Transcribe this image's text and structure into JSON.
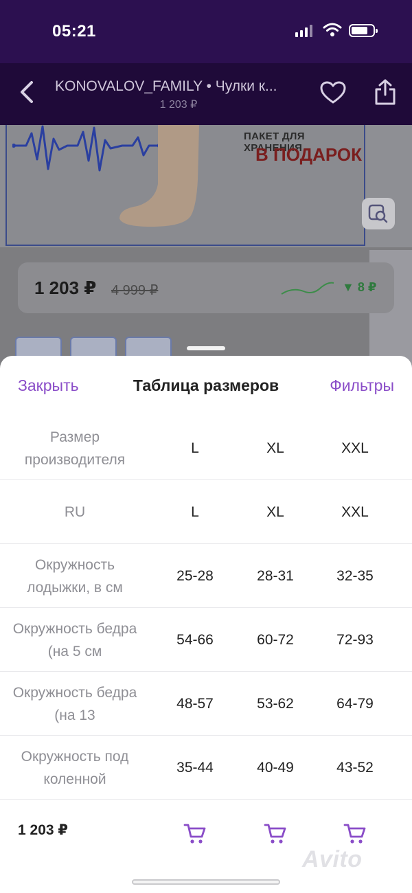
{
  "status_bar": {
    "time": "05:21"
  },
  "nav": {
    "title": "KONOVALOV_FAMILY • Чулки к...",
    "price": "1 203 ₽"
  },
  "banner": {
    "line1": "ПАКЕТ ДЛЯ ХРАНЕНИЯ",
    "line2": "В ПОДАРОК"
  },
  "price_card": {
    "price": "1 203 ₽",
    "old_price": "4 999 ₽",
    "drop": "▼ 8 ₽"
  },
  "sheet": {
    "close_label": "Закрыть",
    "title": "Таблица размеров",
    "filters_label": "Фильтры"
  },
  "size_table": {
    "rows": [
      {
        "label": "Размер производителя",
        "values": [
          "L",
          "XL",
          "XXL"
        ]
      },
      {
        "label": "RU",
        "values": [
          "L",
          "XL",
          "XXL"
        ]
      },
      {
        "label": "Окружность лодыжки, в см",
        "values": [
          "25-28",
          "28-31",
          "32-35"
        ]
      },
      {
        "label": "Окружность бедра (на 5 см",
        "values": [
          "54-66",
          "60-72",
          "72-93"
        ]
      },
      {
        "label": "Окружность бедра (на 13",
        "values": [
          "48-57",
          "53-62",
          "64-79"
        ]
      },
      {
        "label": "Окружность под коленной",
        "values": [
          "35-44",
          "40-49",
          "43-52"
        ]
      }
    ]
  },
  "footer": {
    "price": "1 203 ₽"
  },
  "watermark": "Avito",
  "colors": {
    "accent": "#8a4dc8",
    "status_bg": "#2c1050",
    "nav_bg": "#1f0a39"
  },
  "icons": [
    "back-icon",
    "heart-icon",
    "share-icon",
    "zoom-search-icon",
    "cart-icon"
  ]
}
